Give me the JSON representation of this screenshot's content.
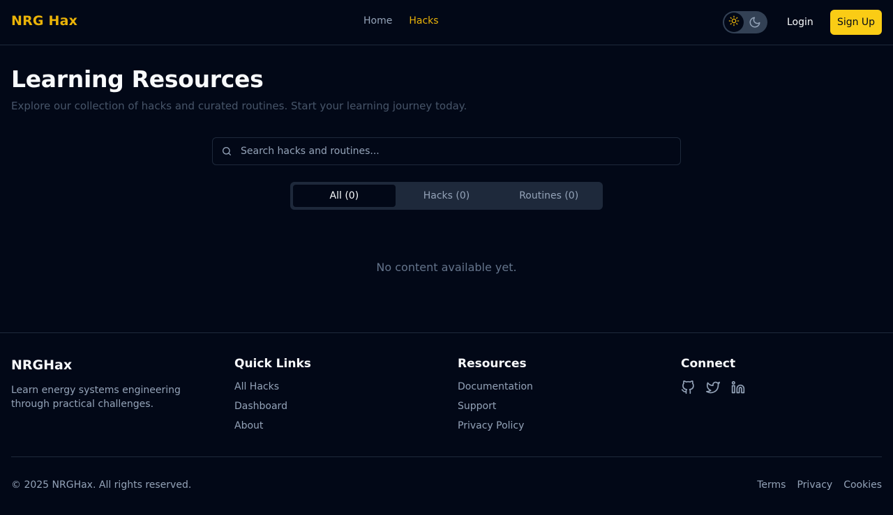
{
  "header": {
    "logo": "NRG Hax",
    "nav": {
      "home": "Home",
      "hacks": "Hacks"
    },
    "theme_toggle": {
      "light_icon": "sun-icon",
      "dark_icon": "moon-icon",
      "active": "light"
    },
    "login_label": "Login",
    "signup_label": "Sign Up"
  },
  "main": {
    "title": "Learning Resources",
    "subtitle": "Explore our collection of hacks and curated routines. Start your learning journey today.",
    "search": {
      "placeholder": "Search hacks and routines...",
      "value": ""
    },
    "tabs": [
      {
        "label": "All (0)",
        "active": true
      },
      {
        "label": "Hacks (0)",
        "active": false
      },
      {
        "label": "Routines (0)",
        "active": false
      }
    ],
    "empty_message": "No content available yet."
  },
  "footer": {
    "brand": "NRGHax",
    "description": "Learn energy systems engineering through practical challenges.",
    "quick_links": {
      "heading": "Quick Links",
      "items": [
        "All Hacks",
        "Dashboard",
        "About"
      ]
    },
    "resources": {
      "heading": "Resources",
      "items": [
        "Documentation",
        "Support",
        "Privacy Policy"
      ]
    },
    "connect": {
      "heading": "Connect",
      "icons": [
        "github-icon",
        "twitter-icon",
        "linkedin-icon"
      ]
    },
    "copyright": "© 2025 NRGHax. All rights reserved.",
    "legal": [
      "Terms",
      "Privacy",
      "Cookies"
    ]
  },
  "colors": {
    "background": "#020817",
    "accent": "#eab308",
    "button": "#facc15",
    "muted_text": "#94a3b8",
    "border": "#1e293b"
  }
}
